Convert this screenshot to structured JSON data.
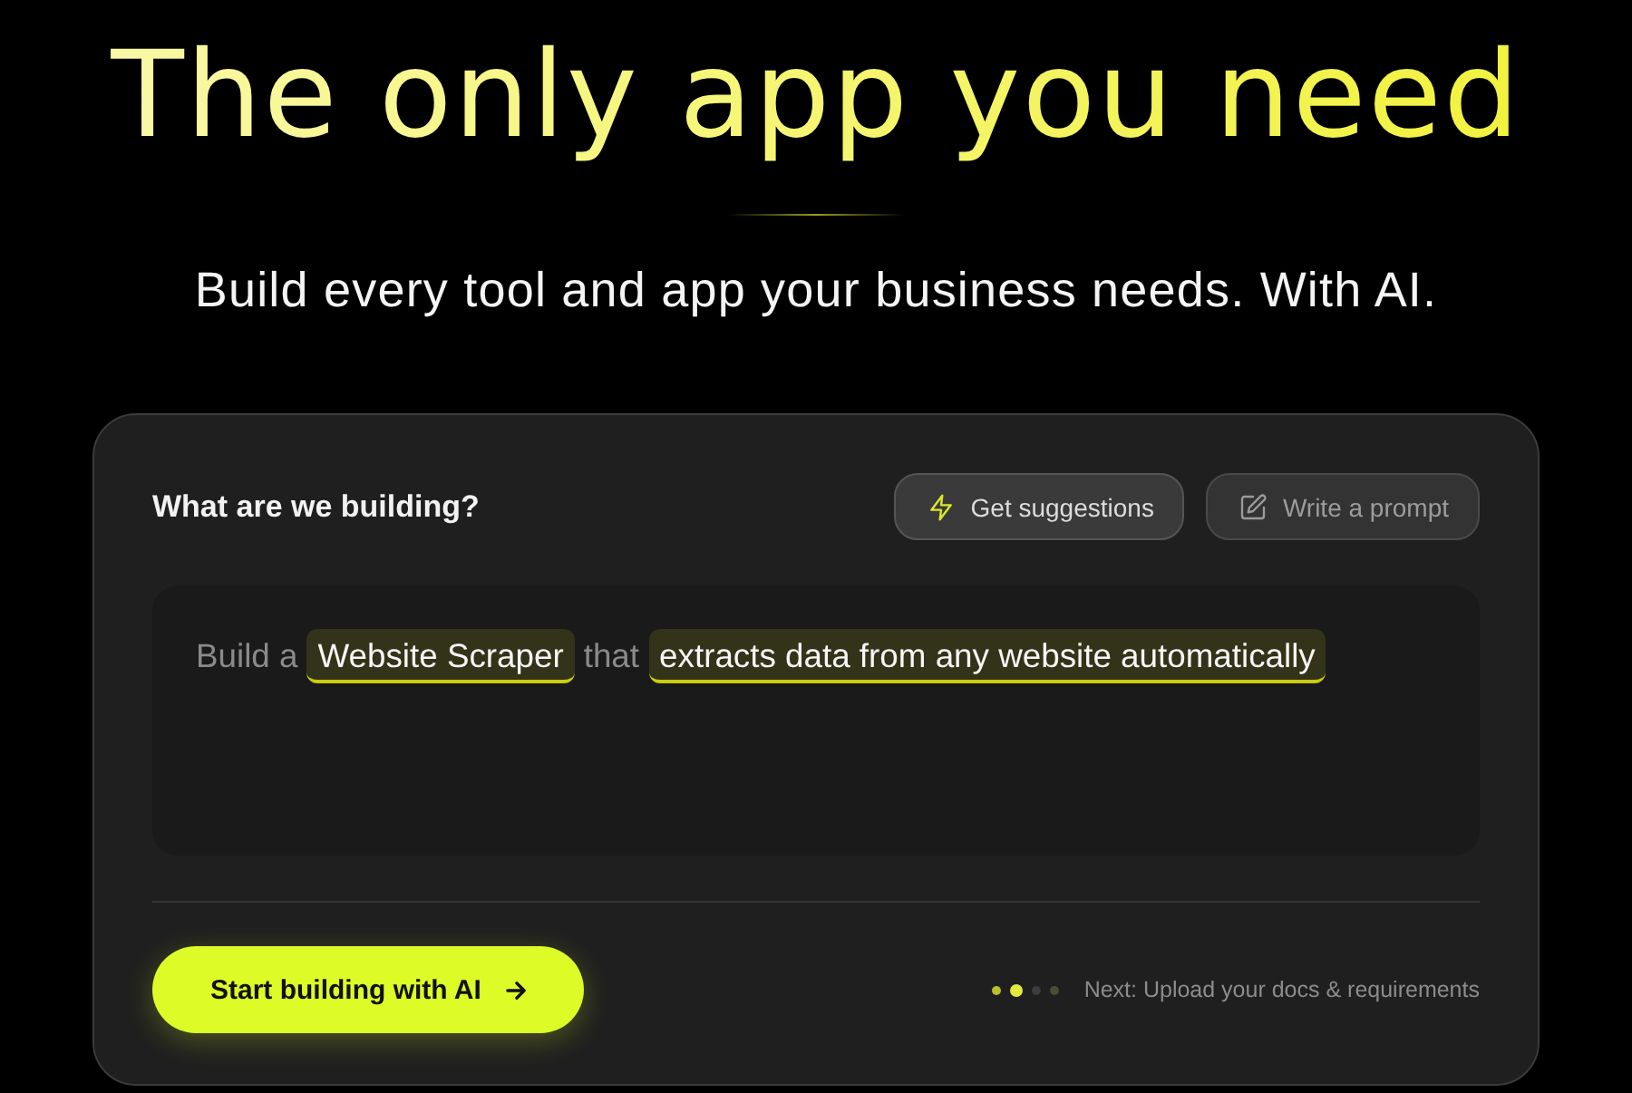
{
  "hero": {
    "title": "The only app you need",
    "subtitle": "Build every tool and app your business needs. With AI."
  },
  "builder": {
    "heading": "What are we building?",
    "modes": [
      {
        "kind": "suggest",
        "label": "Get suggestions",
        "selected": true
      },
      {
        "kind": "write",
        "label": "Write a prompt",
        "selected": false
      }
    ],
    "prompt": {
      "segments": [
        {
          "kind": "text",
          "text": "Build a"
        },
        {
          "kind": "token",
          "text": "Website Scraper"
        },
        {
          "kind": "text",
          "text": "that"
        },
        {
          "kind": "token",
          "text": "extracts data from any website automatically"
        }
      ]
    },
    "start_button": {
      "label": "Start building with AI"
    },
    "progress": {
      "steps": [
        {
          "color": "#b9bf2c",
          "selected": false
        },
        {
          "color": "#e3ea3c",
          "selected": true
        },
        {
          "color": "#3c3c3c",
          "selected": false
        },
        {
          "color": "#4b4e2e",
          "selected": false
        }
      ],
      "next_label": "Next: Upload your docs & requirements"
    }
  }
}
